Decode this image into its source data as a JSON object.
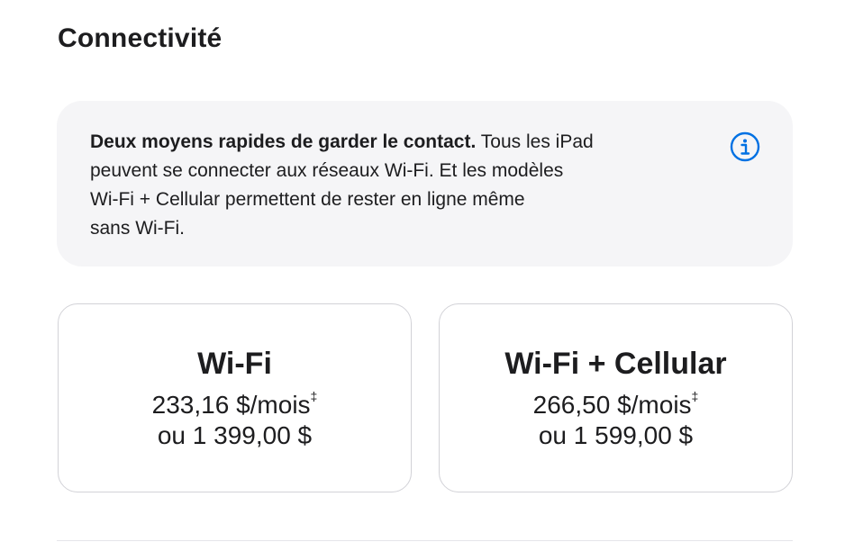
{
  "section": {
    "title": "Connectivité"
  },
  "info": {
    "bold_text": "Deux moyens rapides de garder le contact.",
    "line1_rest": " Tous les iPad",
    "line2": "peuvent se connecter aux réseaux Wi-Fi. Et les modèles",
    "line3": "Wi-Fi + Cellular permettent de rester en ligne même",
    "line4": "sans Wi-Fi.",
    "icon": "info-circle-icon",
    "icon_color": "#0071e3"
  },
  "options": [
    {
      "title": "Wi-Fi",
      "monthly_price": "233,16 $/mois",
      "footnote_mark": "‡",
      "full_price": "ou 1 399,00 $"
    },
    {
      "title": "Wi-Fi + Cellular",
      "monthly_price": "266,50 $/mois",
      "footnote_mark": "‡",
      "full_price": "ou 1 599,00 $"
    }
  ],
  "colors": {
    "text": "#1d1d1f",
    "info_background": "#f5f5f7",
    "card_border": "#d2d2d7",
    "accent": "#0071e3"
  }
}
